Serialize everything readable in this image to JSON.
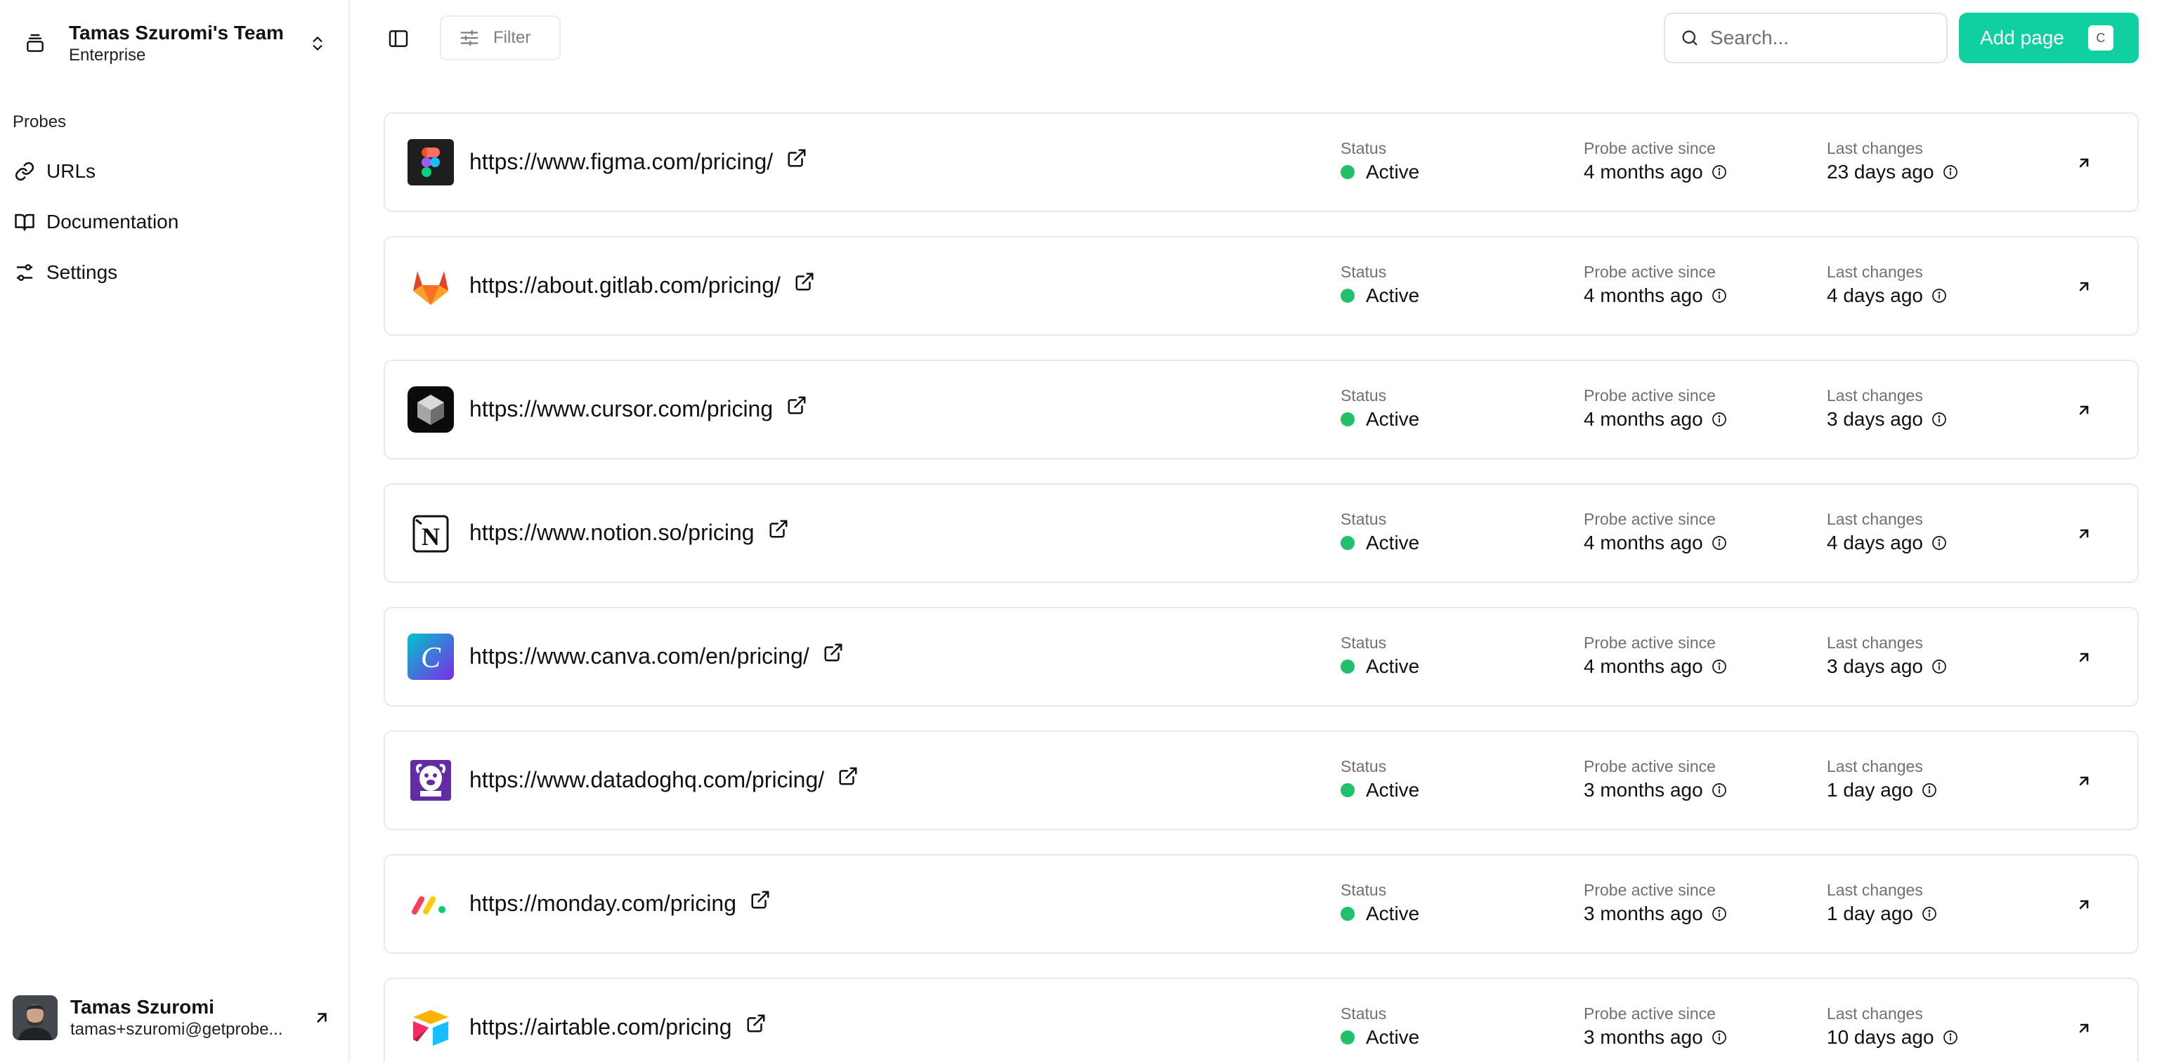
{
  "team": {
    "name": "Tamas Szuromi's Team",
    "plan": "Enterprise"
  },
  "sidebar": {
    "section_label": "Probes",
    "items": [
      {
        "label": "URLs",
        "icon": "link-icon"
      },
      {
        "label": "Documentation",
        "icon": "book-icon"
      },
      {
        "label": "Settings",
        "icon": "sliders-icon"
      }
    ]
  },
  "user": {
    "name": "Tamas Szuromi",
    "email": "tamas+szuromi@getprobe..."
  },
  "toolbar": {
    "filter_label": "Filter",
    "search_placeholder": "Search...",
    "add_label": "Add page",
    "add_shortcut": "C"
  },
  "columns": {
    "status": "Status",
    "since": "Probe active since",
    "changes": "Last changes"
  },
  "rows": [
    {
      "url": "https://www.figma.com/pricing/",
      "status": "Active",
      "since": "4 months ago",
      "changes": "23 days ago",
      "logo": "figma"
    },
    {
      "url": "https://about.gitlab.com/pricing/",
      "status": "Active",
      "since": "4 months ago",
      "changes": "4 days ago",
      "logo": "gitlab"
    },
    {
      "url": "https://www.cursor.com/pricing",
      "status": "Active",
      "since": "4 months ago",
      "changes": "3 days ago",
      "logo": "cursor"
    },
    {
      "url": "https://www.notion.so/pricing",
      "status": "Active",
      "since": "4 months ago",
      "changes": "4 days ago",
      "logo": "notion"
    },
    {
      "url": "https://www.canva.com/en/pricing/",
      "status": "Active",
      "since": "4 months ago",
      "changes": "3 days ago",
      "logo": "canva"
    },
    {
      "url": "https://www.datadoghq.com/pricing/",
      "status": "Active",
      "since": "3 months ago",
      "changes": "1 day ago",
      "logo": "datadog"
    },
    {
      "url": "https://monday.com/pricing",
      "status": "Active",
      "since": "3 months ago",
      "changes": "1 day ago",
      "logo": "monday"
    },
    {
      "url": "https://airtable.com/pricing",
      "status": "Active",
      "since": "3 months ago",
      "changes": "10 days ago",
      "logo": "airtable"
    }
  ],
  "colors": {
    "accent": "#10cfa0",
    "status_active": "#22c06a",
    "border": "#e8e9ec"
  }
}
